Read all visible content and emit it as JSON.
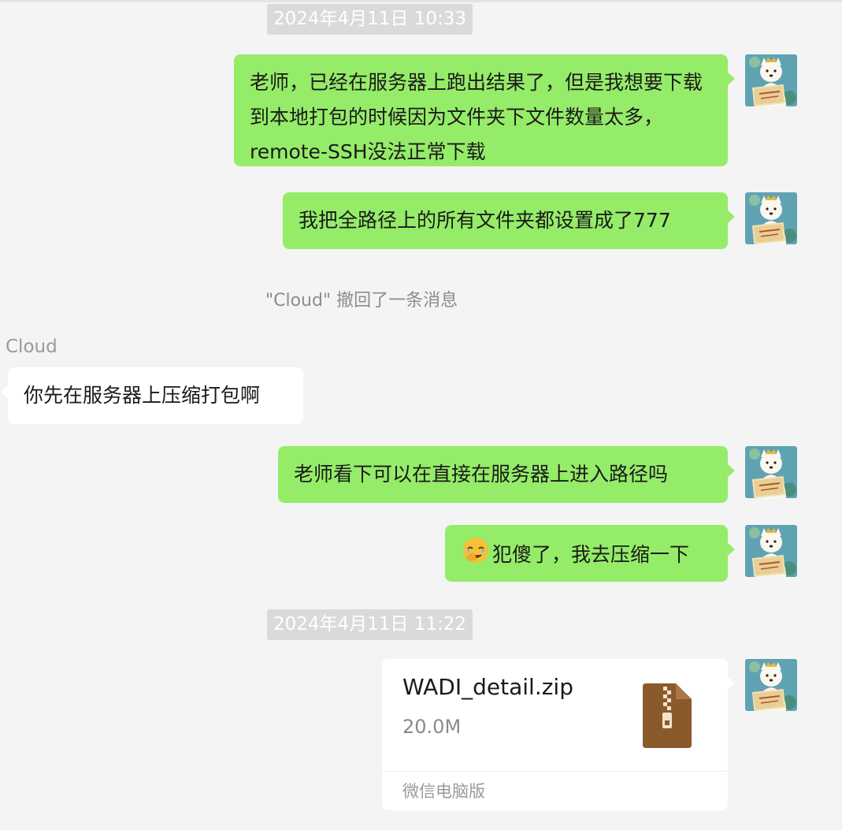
{
  "messages": [
    {
      "type": "timestamp",
      "text": "2024年4月11日 10:33"
    },
    {
      "type": "outgoing",
      "text": "老师，已经在服务器上跑出结果了，但是我想要下载到本地打包的时候因为文件夹下文件数量太多，remote-SSH没法正常下载"
    },
    {
      "type": "outgoing",
      "text": "我把全路径上的所有文件夹都设置成了777"
    },
    {
      "type": "system",
      "text": "\"Cloud\" 撤回了一条消息"
    },
    {
      "type": "sender",
      "name": "Cloud"
    },
    {
      "type": "incoming",
      "text": "你先在服务器上压缩打包啊"
    },
    {
      "type": "outgoing",
      "text": "老师看下可以在直接在服务器上进入路径吗"
    },
    {
      "type": "outgoing",
      "emoji": "facepalm-emoji",
      "text": "犯傻了，我去压缩一下"
    },
    {
      "type": "timestamp",
      "text": "2024年4月11日 11:22"
    },
    {
      "type": "file",
      "file_name": "WADI_detail.zip",
      "file_size": "20.0M",
      "source": "微信电脑版",
      "icon": "zip-file-icon"
    }
  ],
  "colors": {
    "outgoing_bubble": "#95ec69",
    "incoming_bubble": "#ffffff",
    "background": "#f4f4f4",
    "timestamp_bg": "#dadada",
    "zip_icon": "#8b5a2b"
  },
  "avatar_icon": "dog-reading-book-avatar"
}
